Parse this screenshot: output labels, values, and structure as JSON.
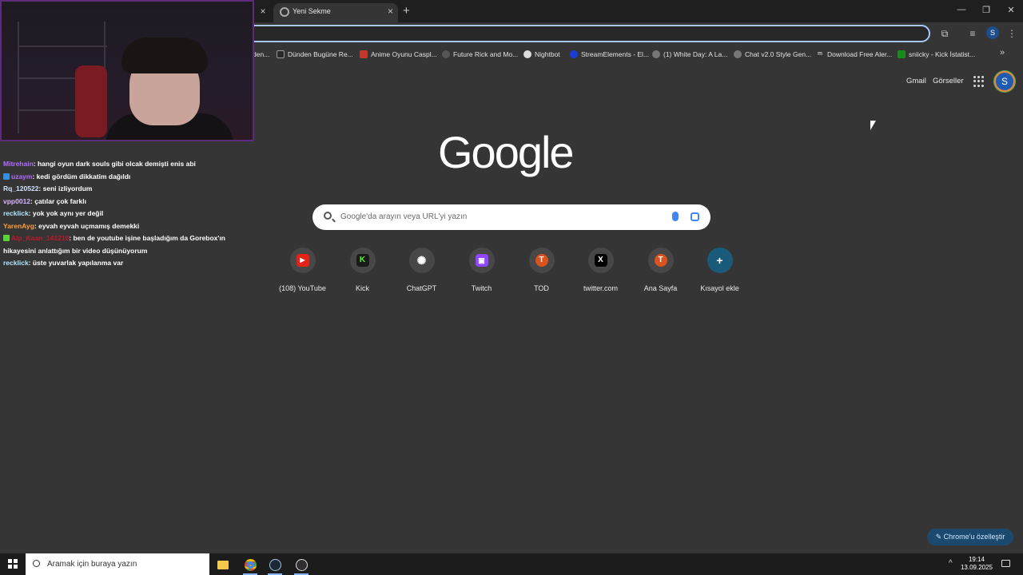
{
  "tabs": {
    "active_title": "Yeni Sekme",
    "close_prev": "×",
    "close_active": "×",
    "new_tab": "+"
  },
  "window_controls": {
    "minimize": "—",
    "restore": "❐",
    "close": "✕"
  },
  "bookmarks": [
    {
      "label": "den...",
      "icon": "globe-icon",
      "color": "#777777"
    },
    {
      "label": "Dünden Bugüne Re...",
      "icon": "triangle-icon",
      "color": "#2a2a2a"
    },
    {
      "label": "Anime Oyunu Caspl...",
      "icon": "shield-icon",
      "color": "#c0392b"
    },
    {
      "label": "Future Rick and Mo...",
      "icon": "link-icon",
      "color": "#555555"
    },
    {
      "label": "Nightbot",
      "icon": "robot-icon",
      "color": "#dddddd"
    },
    {
      "label": "StreamElements - El...",
      "icon": "streamelements-icon",
      "color": "#1a3bd6"
    },
    {
      "label": "(1) White Day: A La...",
      "icon": "globe-icon",
      "color": "#777777"
    },
    {
      "label": "Chat v2.0 Style Gen...",
      "icon": "globe-icon",
      "color": "#777777"
    },
    {
      "label": "Download Free Aler...",
      "icon": "m-icon",
      "color": "#333333"
    },
    {
      "label": "sniicky - Kick İstatist...",
      "icon": "kick-icon",
      "color": "#1b8a1b"
    }
  ],
  "bookmarks_more": "»",
  "google": {
    "gmail": "Gmail",
    "images": "Görseller",
    "avatar_letter": "S",
    "logo": "Google",
    "search_placeholder": "Google'da arayın veya URL'yi yazın",
    "customize_label": "✎ Chrome'u özelleştir"
  },
  "shortcuts": [
    {
      "label": "(108) YouTube",
      "glyph": "▶",
      "color": "#e62117"
    },
    {
      "label": "Kick",
      "glyph": "K",
      "color": "#1a1a1a",
      "text_color": "#53fc18"
    },
    {
      "label": "ChatGPT",
      "glyph": "✺",
      "color": "#474747"
    },
    {
      "label": "Twitch",
      "glyph": "▣",
      "color": "#9146ff"
    },
    {
      "label": "TOD",
      "glyph": "T",
      "color": "#d9531e"
    },
    {
      "label": "twitter.com",
      "glyph": "X",
      "color": "#000000"
    },
    {
      "label": "Ana Sayfa",
      "glyph": "T",
      "color": "#d9531e"
    },
    {
      "label": "Kısayol ekle",
      "glyph": "+",
      "color": "#1a5a7a"
    }
  ],
  "chat": [
    {
      "user": "Mitrehain",
      "user_color": "#b36bff",
      "badge": "",
      "text": ": hangi oyun dark souls gibi olcak demişti enis abi"
    },
    {
      "user": "uzaym",
      "user_color": "#b36bff",
      "badge": "#3a8dde",
      "text": ": kedi gördüm dikkatim dağıldı"
    },
    {
      "user": "Rq_120522",
      "user_color": "#cfe3ff",
      "badge": "",
      "text": ": seni izliyordum"
    },
    {
      "user": "vpp0012",
      "user_color": "#d9b3ff",
      "badge": "",
      "text": ": çatılar çok farklı"
    },
    {
      "user": "recklick",
      "user_color": "#aee8ff",
      "badge": "",
      "text": ": yok yok aynı yer değil"
    },
    {
      "user": "YarenAyg",
      "user_color": "#ff9d3b",
      "badge": "",
      "text": ": eyvah eyvah uçmamış demekki"
    },
    {
      "user": "Alp_Kaan_141216",
      "user_color": "#c0182a",
      "badge": "#5bd13a",
      "text": ": ben de youtube işine başladığım da Gorebox'ın hikayesini anlattığım bir video düşünüyorum"
    },
    {
      "user": "recklick",
      "user_color": "#aee8ff",
      "badge": "",
      "text": ": üste yuvarlak yapılanma var"
    }
  ],
  "taskbar": {
    "search_placeholder": "Aramak için buraya yazın",
    "apps": [
      "file-explorer-icon",
      "chrome-icon",
      "steam-icon",
      "obs-icon"
    ],
    "tray_chevron": "^",
    "time": "19:14",
    "date": "13.09.2025"
  }
}
